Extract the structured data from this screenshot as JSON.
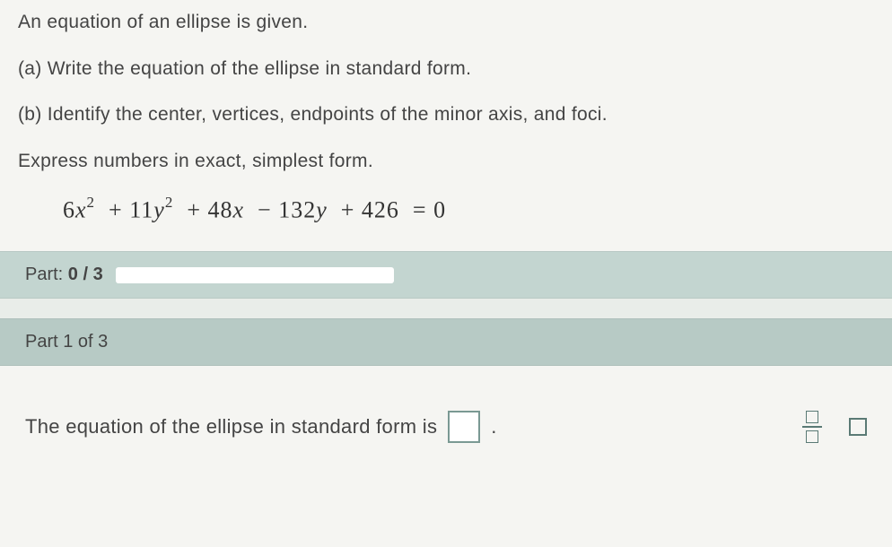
{
  "problem": {
    "intro": "An equation of an ellipse is given.",
    "part_a": "(a) Write the equation of the ellipse in standard form.",
    "part_b": "(b) Identify the center, vertices, endpoints of the minor axis, and foci.",
    "instruction": "Express numbers in exact, simplest form.",
    "equation": {
      "ax2_coef": "6",
      "x_var": "x",
      "by2_coef": "11",
      "y_var": "y",
      "cx_coef": "48",
      "dy_coef": "132",
      "constant": "426",
      "rhs": "0"
    }
  },
  "progress": {
    "label_prefix": "Part: ",
    "current": "0",
    "separator": " / ",
    "total": "3"
  },
  "part1": {
    "header": "Part 1 of 3",
    "prompt": "The equation of the ellipse in standard form is"
  }
}
